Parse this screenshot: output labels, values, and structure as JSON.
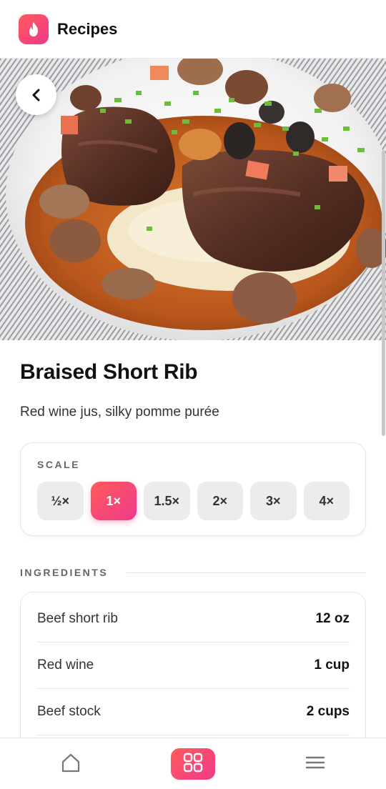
{
  "header": {
    "title": "Recipes",
    "logo_icon": "flame-icon"
  },
  "hero": {
    "image": "braised-short-rib-photo",
    "back_icon": "chevron-left-icon"
  },
  "recipe": {
    "title": "Braised Short Rib",
    "subtitle": "Red wine jus, silky pomme purée"
  },
  "scale": {
    "label": "SCALE",
    "options": [
      "½×",
      "1×",
      "1.5×",
      "2×",
      "3×",
      "4×"
    ],
    "selected": "1×"
  },
  "ingredients": {
    "heading": "INGREDIENTS",
    "items": [
      {
        "name": "Beef short rib",
        "qty": "12 oz"
      },
      {
        "name": "Red wine",
        "qty": "1 cup"
      },
      {
        "name": "Beef stock",
        "qty": "2 cups"
      }
    ]
  },
  "nav": {
    "items": [
      {
        "icon": "home-icon"
      },
      {
        "icon": "grid-icon",
        "active": true
      },
      {
        "icon": "menu-icon"
      }
    ]
  },
  "colors": {
    "accent_start": "#ff5a5a",
    "accent_end": "#ef3a8c"
  }
}
